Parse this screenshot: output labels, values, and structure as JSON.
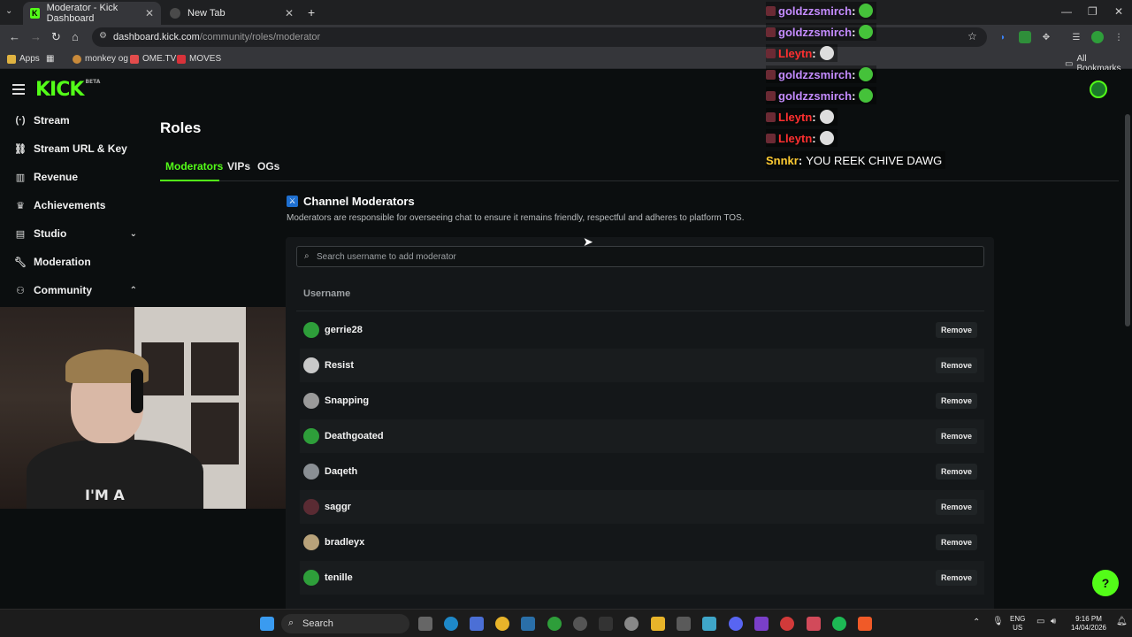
{
  "browser": {
    "tabs": [
      {
        "title": "Moderator - Kick Dashboard",
        "active": true
      },
      {
        "title": "New Tab",
        "active": false
      }
    ],
    "new_tab_symbol": "+",
    "url_host": "dashboard.kick.com",
    "url_path": "/community/roles/moderator",
    "bookmarks": [
      {
        "label": "Apps"
      },
      {
        "label": "monkey og"
      },
      {
        "label": "OME.TV"
      },
      {
        "label": "MOVES"
      }
    ],
    "all_bookmarks": "All Bookmarks"
  },
  "kick": {
    "logo": "KICK",
    "logo_badge": "BETA"
  },
  "sidebar": {
    "items": [
      {
        "label": "Stream",
        "icon": "broadcast-icon"
      },
      {
        "label": "Stream URL & Key",
        "icon": "link-icon"
      },
      {
        "label": "Revenue",
        "icon": "chart-icon"
      },
      {
        "label": "Achievements",
        "icon": "trophy-icon"
      },
      {
        "label": "Studio",
        "icon": "studio-icon",
        "chevron": "down"
      },
      {
        "label": "Moderation",
        "icon": "wrench-icon"
      },
      {
        "label": "Community",
        "icon": "community-icon",
        "chevron": "up"
      }
    ]
  },
  "main": {
    "title": "Roles",
    "tabs": [
      {
        "label": "Moderators",
        "active": true
      },
      {
        "label": "VIPs",
        "active": false
      },
      {
        "label": "OGs",
        "active": false
      }
    ],
    "section_title": "Channel Moderators",
    "section_desc": "Moderators are responsible for overseeing chat to ensure it remains friendly, respectful and adheres to platform TOS.",
    "search_placeholder": "Search username to add moderator",
    "column_header": "Username",
    "remove_label": "Remove",
    "moderators": [
      {
        "name": "gerrie28",
        "avatar": "#2e9e3a"
      },
      {
        "name": "Resist",
        "avatar": "#c9c9c9"
      },
      {
        "name": "Snapping",
        "avatar": "#9a9a9a"
      },
      {
        "name": "Deathgoated",
        "avatar": "#2e9e3a"
      },
      {
        "name": "Daqeth",
        "avatar": "#8a8f94"
      },
      {
        "name": "saggr",
        "avatar": "#5a2b33"
      },
      {
        "name": "bradleyx",
        "avatar": "#b8a27a"
      },
      {
        "name": "tenille",
        "avatar": "#2e9e3a"
      }
    ]
  },
  "chat_overlay": [
    {
      "user": "goldzzsmirch",
      "color": "#c58cff",
      "emote": "#45c23a",
      "message": ""
    },
    {
      "user": "goldzzsmirch",
      "color": "#c58cff",
      "emote": "#45c23a",
      "message": ""
    },
    {
      "user": "Lleytn",
      "color": "#ff3030",
      "emote": "#dddddd",
      "message": ""
    },
    {
      "user": "goldzzsmirch",
      "color": "#c58cff",
      "emote": "#45c23a",
      "message": ""
    },
    {
      "user": "goldzzsmirch",
      "color": "#c58cff",
      "emote": "#45c23a",
      "message": ""
    },
    {
      "user": "Lleytn",
      "color": "#ff3030",
      "emote": "#dddddd",
      "message": ""
    },
    {
      "user": "Lleytn",
      "color": "#ff3030",
      "emote": "#dddddd",
      "message": ""
    },
    {
      "user": "Snnkr",
      "color": "#ffcc33",
      "emote": "",
      "message": "YOU REEK CHIVE DAWG"
    }
  ],
  "webcam": {
    "shirt_text": "I'M A"
  },
  "taskbar": {
    "search_label": "Search",
    "lang_line1": "ENG",
    "lang_line2": "US",
    "time": "9:16 PM",
    "date": "14/04/2026"
  },
  "colors": {
    "kick_green": "#53fc18",
    "background": "#0b0e0f",
    "panel": "#141719"
  }
}
